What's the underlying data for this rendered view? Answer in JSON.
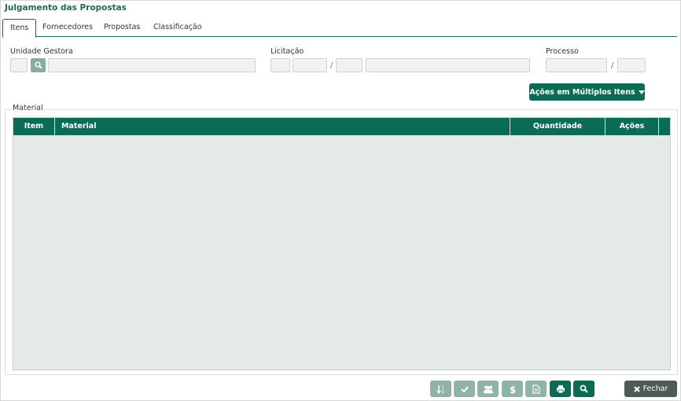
{
  "title": "Julgamento das Propostas",
  "tabs": [
    {
      "label": "Itens"
    },
    {
      "label": "Fornecedores"
    },
    {
      "label": "Propostas"
    },
    {
      "label": "Classificação"
    }
  ],
  "filters": {
    "unidade_gestora_label": "Unidade Gestora",
    "licitacao_label": "Licitação",
    "processo_label": "Processo",
    "separator": "/"
  },
  "actions": {
    "multi_items_label": "Ações em Múltiplos Itens"
  },
  "material": {
    "legend": "Material",
    "columns": [
      "Item",
      "Material",
      "Quantidade",
      "Ações"
    ]
  },
  "footer": {
    "close_label": "Fechar",
    "buttons": [
      "sort-icon",
      "check-icon",
      "group-icon",
      "dollar-icon",
      "document-icon",
      "print-icon",
      "search-icon"
    ]
  },
  "colors": {
    "primary": "#0b6b55",
    "disabled": "#8fb3a7",
    "close": "#4e5a58"
  }
}
